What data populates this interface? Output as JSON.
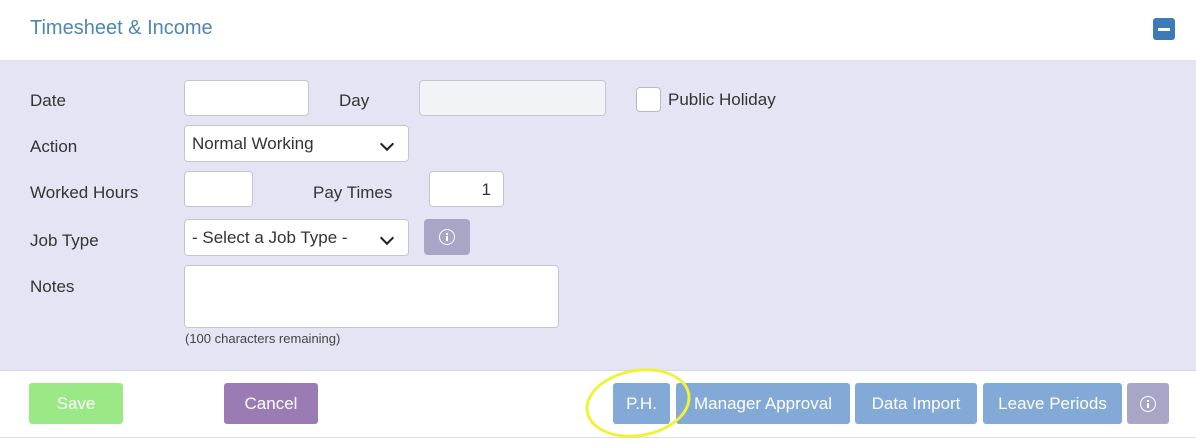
{
  "panel": {
    "title": "Timesheet & Income"
  },
  "form": {
    "date_label": "Date",
    "date_value": "",
    "day_label": "Day",
    "day_value": "",
    "public_holiday_label": "Public Holiday",
    "public_holiday_checked": false,
    "action_label": "Action",
    "action_selected": "Normal Working",
    "worked_hours_label": "Worked Hours",
    "worked_hours_value": "",
    "pay_times_label": "Pay Times",
    "pay_times_value": "1",
    "job_type_label": "Job Type",
    "job_type_selected": "- Select a Job Type -",
    "notes_label": "Notes",
    "notes_value": "",
    "notes_hint": "(100 characters remaining)"
  },
  "footer": {
    "save_label": "Save",
    "cancel_label": "Cancel",
    "ph_label": "P.H.",
    "manager_approval_label": "Manager Approval",
    "data_import_label": "Data Import",
    "leave_periods_label": "Leave Periods"
  },
  "icons": {
    "collapse": "minus-square-icon",
    "info": "info-circle-icon",
    "dropdown": "chevron-down-icon"
  },
  "colors": {
    "title": "#4f86b3",
    "form_background": "#e5e4f5",
    "save": "#9be886",
    "cancel": "#9b7bb3",
    "action_buttons": "#83a9d6",
    "info_button": "#a7a6c7",
    "highlight": "#f0f23a"
  }
}
